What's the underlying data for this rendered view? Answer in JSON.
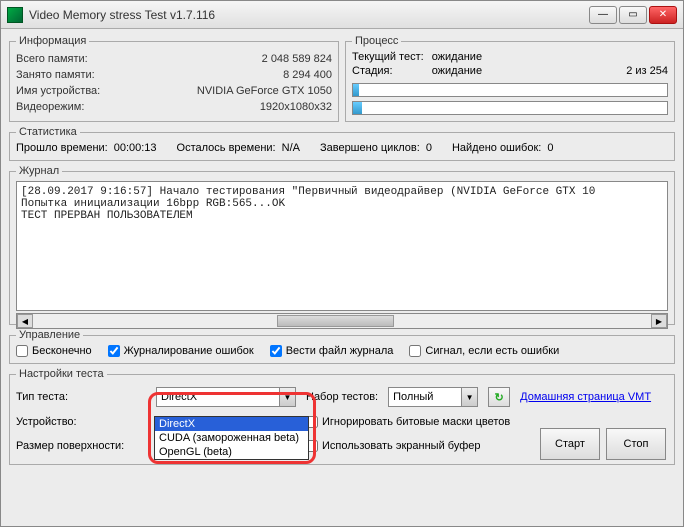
{
  "window": {
    "title": "Video Memory stress Test v1.7.116"
  },
  "info": {
    "legend": "Информация",
    "total_mem_k": "Всего памяти:",
    "total_mem_v": "2 048 589 824",
    "used_mem_k": "Занято памяти:",
    "used_mem_v": "8 294 400",
    "device_k": "Имя устройства:",
    "device_v": "NVIDIA GeForce GTX 1050",
    "mode_k": "Видеорежим:",
    "mode_v": "1920x1080x32"
  },
  "process": {
    "legend": "Процесс",
    "cur_test_k": "Текущий тест:",
    "cur_test_v": "ожидание",
    "stage_k": "Стадия:",
    "stage_v": "ожидание",
    "counter": "2 из 254"
  },
  "stats": {
    "legend": "Статистика",
    "elapsed_k": "Прошло времени:",
    "elapsed_v": "00:00:13",
    "remain_k": "Осталось времени:",
    "remain_v": "N/A",
    "cycles_k": "Завершено циклов:",
    "cycles_v": "0",
    "errors_k": "Найдено ошибок:",
    "errors_v": "0"
  },
  "journal": {
    "legend": "Журнал",
    "text": "[28.09.2017 9:16:57] Начало тестирования \"Первичный видеодрайвер (NVIDIA GeForce GTX 10\nПопытка инициализации 16bpp RGB:565...OK\nТЕСТ ПРЕРВАН ПОЛЬЗОВАТЕЛЕМ"
  },
  "control": {
    "legend": "Управление",
    "infinite": "Бесконечно",
    "log_errors": "Журналирование ошибок",
    "log_file": "Вести файл журнала",
    "signal": "Сигнал, если есть ошибки"
  },
  "settings": {
    "legend": "Настройки теста",
    "type_k": "Тип теста:",
    "type_v": "DirectX",
    "type_options": [
      "DirectX",
      "CUDA (замороженная beta)",
      "OpenGL (beta)"
    ],
    "set_k": "Набор тестов:",
    "set_v": "Полный",
    "home_link": "Домашняя страница VMT",
    "device_k": "Устройство:",
    "ignore_masks": "Игнорировать битовые маски цветов",
    "surface_k": "Размер поверхности:",
    "use_buffer": "Использовать экранный буфер",
    "start": "Старт",
    "stop": "Стоп"
  }
}
